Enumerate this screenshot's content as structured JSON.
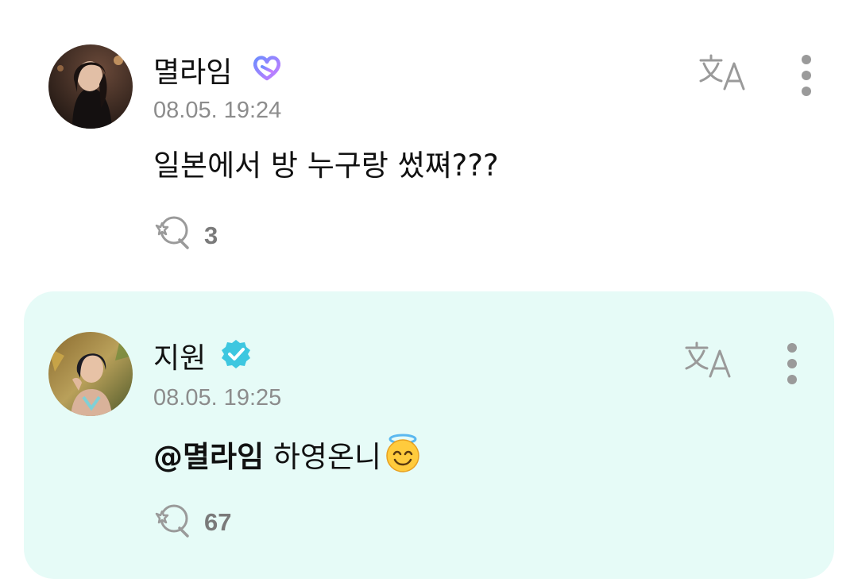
{
  "comments": [
    {
      "username": "멸라임",
      "badge": "heart-link-icon",
      "timestamp": "08.05. 19:24",
      "text": "일본에서 방 누구랑 썼쪄???",
      "likes": "3",
      "translate_icon": "translate-icon",
      "more_icon": "more-vertical-icon"
    },
    {
      "username": "지원",
      "badge": "verified-icon",
      "timestamp": "08.05. 19:25",
      "mention": "@멸라임",
      "text": " 하영온니",
      "emoji": "smiling-face-with-halo-emoji",
      "likes": "67",
      "translate_icon": "translate-icon",
      "more_icon": "more-vertical-icon"
    }
  ],
  "colors": {
    "reply_background": "#e6fbf7",
    "verified_badge": "#3ec7e0",
    "heart_badge_start": "#6e8cff",
    "heart_badge_end": "#c97cff",
    "timestamp": "#8c8c8c",
    "icon_gray": "#9a9a9a"
  }
}
